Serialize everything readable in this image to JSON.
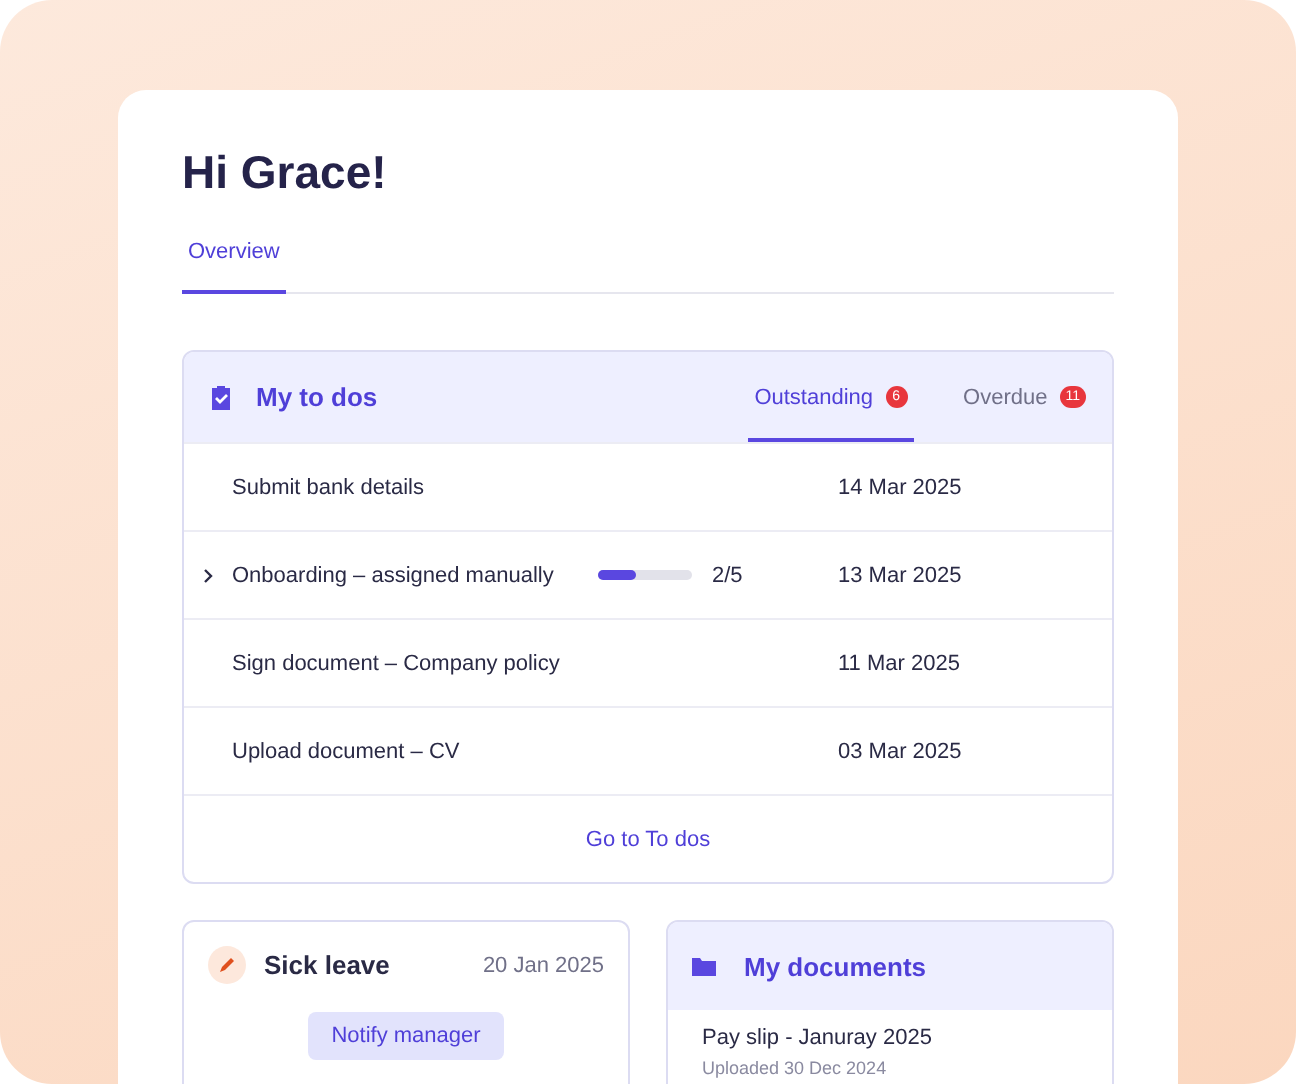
{
  "greeting": "Hi Grace!",
  "tabs": [
    {
      "label": "Overview",
      "selected": true
    }
  ],
  "todos": {
    "title": "My to dos",
    "tabs": [
      {
        "label": "Outstanding",
        "count": "6",
        "selected": true
      },
      {
        "label": "Overdue",
        "count": "11",
        "selected": false
      }
    ],
    "rows": [
      {
        "kind": "task",
        "title": "Submit bank details",
        "date": "14 Mar 2025"
      },
      {
        "kind": "group",
        "title": "Onboarding – assigned manually",
        "expanded": false,
        "level": 0.4,
        "progress": "2/5",
        "date": "13 Mar 2025"
      },
      {
        "kind": "task",
        "title": "Sign document – Company policy",
        "date": "11 Mar 2025"
      },
      {
        "kind": "task",
        "title": "Upload document – CV",
        "date": "03 Mar 2025"
      }
    ],
    "link": "Go to To dos"
  },
  "leave": {
    "title": "Sick leave",
    "date": "20 Jan 2025",
    "button": "Notify manager"
  },
  "documents": {
    "title": "My documents",
    "items": [
      {
        "name": "Pay slip - Januray 2025",
        "meta": "Uploaded 30 Dec 2024"
      }
    ]
  }
}
